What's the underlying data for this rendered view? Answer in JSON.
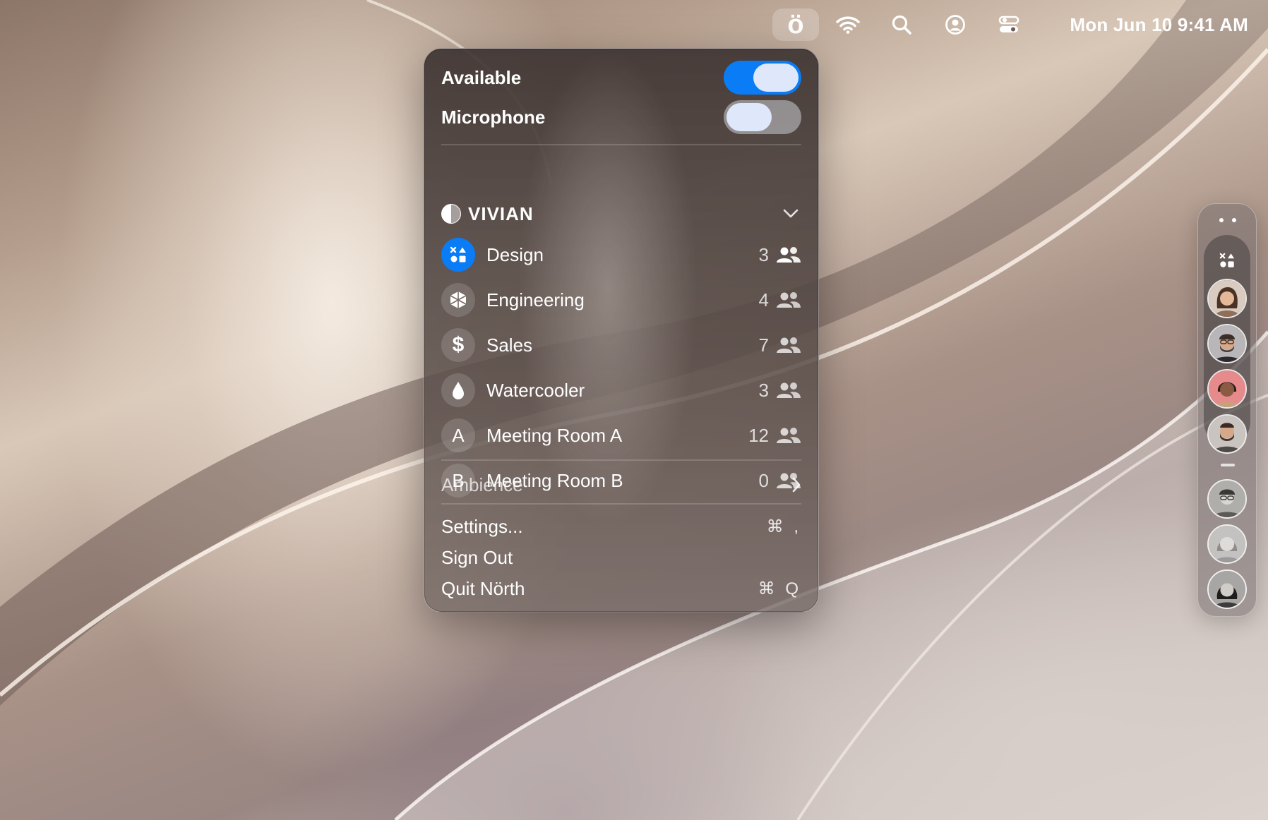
{
  "menubar": {
    "app_glyph": "ö",
    "icons": [
      "app-icon",
      "wifi-icon",
      "search-icon",
      "user-circle-icon",
      "control-center-icon"
    ],
    "clock": "Mon Jun 10  9:41 AM"
  },
  "panel": {
    "toggles": [
      {
        "label": "Available",
        "state": "on"
      },
      {
        "label": "Microphone",
        "state": "off"
      }
    ],
    "org": {
      "name": "VIVIAN",
      "expanded": true
    },
    "rooms": [
      {
        "name": "Design",
        "count": "3",
        "icon": "shapes-icon",
        "active": true
      },
      {
        "name": "Engineering",
        "count": "4",
        "icon": "cube-icon",
        "active": false
      },
      {
        "name": "Sales",
        "count": "7",
        "icon": "dollar-icon",
        "glyph": "$",
        "active": false
      },
      {
        "name": "Watercooler",
        "count": "3",
        "icon": "drop-icon",
        "active": false
      },
      {
        "name": "Meeting Room A",
        "count": "12",
        "icon": "letter-a-icon",
        "glyph": "A",
        "active": false
      },
      {
        "name": "Meeting Room B",
        "count": "0",
        "icon": "letter-b-icon",
        "glyph": "B",
        "active": false
      }
    ],
    "ambience": {
      "label": "Ambience"
    },
    "menu_items": [
      {
        "label": "Settings...",
        "shortcut": "⌘ ,"
      },
      {
        "label": "Sign Out",
        "shortcut": ""
      },
      {
        "label": "Quit Nörth",
        "shortcut": "⌘ Q"
      }
    ]
  },
  "colors": {
    "accent": "#0a7cf5",
    "knob": "#dfe8fb"
  },
  "dock": {
    "room_icon": "shapes-icon",
    "active_members": [
      "avatar-woman-brown-hair",
      "avatar-man-glasses",
      "avatar-woman-pink-bg",
      "avatar-man-beard"
    ],
    "other_members": [
      "avatar-man-glasses-grey",
      "avatar-woman-grey",
      "avatar-woman-dark-hair-grey"
    ]
  }
}
